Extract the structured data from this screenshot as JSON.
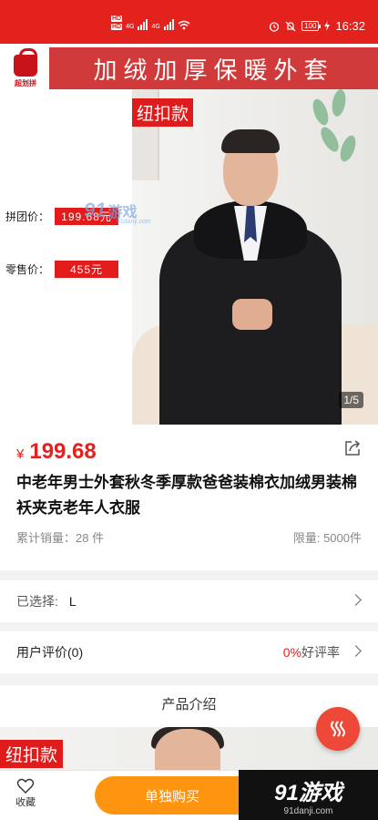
{
  "status_bar": {
    "hd_badges": [
      "HD",
      "HD"
    ],
    "network": [
      "4G",
      "4G"
    ],
    "battery": "100",
    "time": "16:32"
  },
  "hero": {
    "logo_text": "超划拼",
    "banner": "加绒加厚保暖外套",
    "tag": "纽扣款",
    "group_price_label": "拼团价：",
    "group_price": "199.68元",
    "sale_price_label": "零售价：",
    "sale_price": "455元",
    "pager": "1/5",
    "watermark": {
      "num": "91",
      "cn": "游戏",
      "url": "91danji.com"
    }
  },
  "product": {
    "currency": "¥",
    "price": "199.68",
    "title": "中老年男士外套秋冬季厚款爸爸装棉衣加绒男装棉袄夹克老年人衣服",
    "sales": "累计销量：28 件",
    "limit": "限量: 5000件"
  },
  "selected": {
    "label": "已选择:",
    "value": "L"
  },
  "reviews": {
    "label": "用户评价(0)",
    "percent": "0%",
    "percent_suffix": "好评率"
  },
  "intro": {
    "title": "产品介绍",
    "tag": "纽扣款"
  },
  "bottom": {
    "fav_label": "收藏",
    "buy_label": "单独购买",
    "watermark_big": "91游戏",
    "watermark_small": "91danji.com"
  },
  "colors": {
    "brand_red": "#e3211d",
    "buy_orange": "#ff9410",
    "float_red": "#ee4938"
  }
}
